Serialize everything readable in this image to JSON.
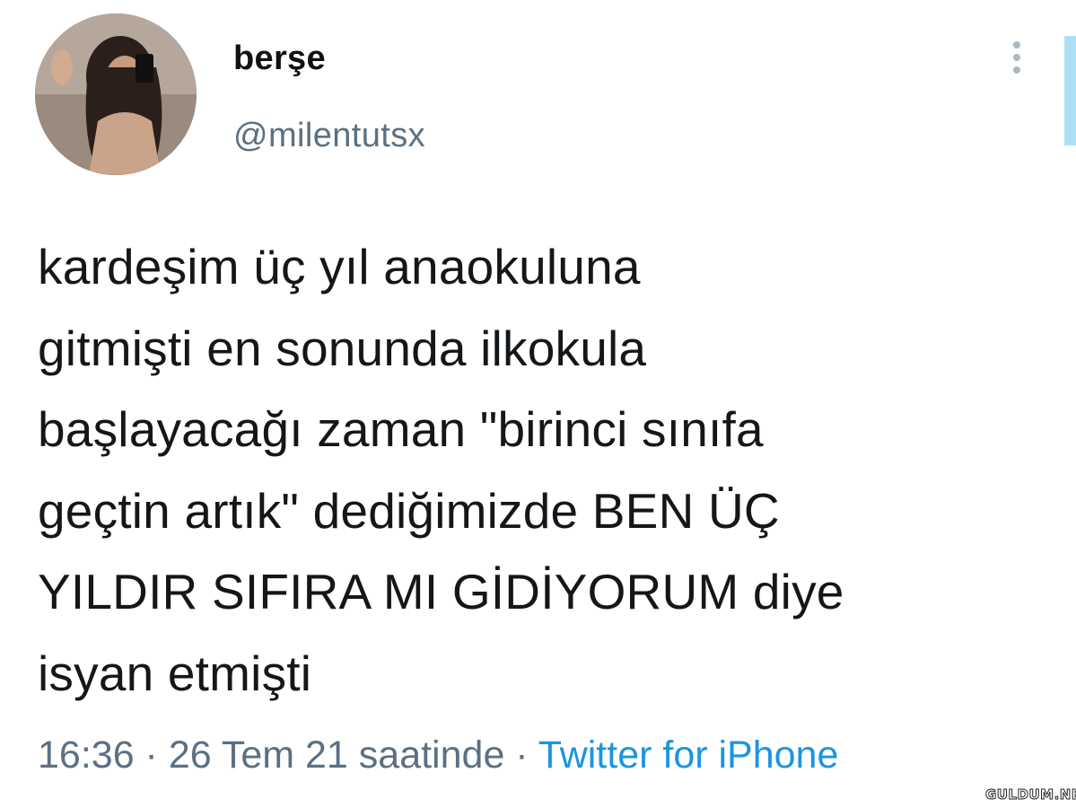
{
  "author": {
    "display_name": "berşe",
    "handle": "@milentutsx",
    "avatar_icon": "profile-photo"
  },
  "tweet": {
    "lines": [
      "kardeşim üç yıl anaokuluna",
      "gitmişti en sonunda ilkokula",
      "başlayacağı zaman \"birinci sınıfa",
      "geçtin artık\" dediğimizde BEN ÜÇ",
      "YILDIR SIFIRA MI GİDİYORUM diye",
      "isyan etmişti"
    ]
  },
  "meta": {
    "time": "16:36",
    "separator": " · ",
    "date": "26 Tem 21 saatinde",
    "source": "Twitter for iPhone"
  },
  "watermark": "GULDUM.NET",
  "colors": {
    "secondary_text": "#5b7083",
    "link": "#1b95e0",
    "menu_dots": "#aab8c2"
  }
}
